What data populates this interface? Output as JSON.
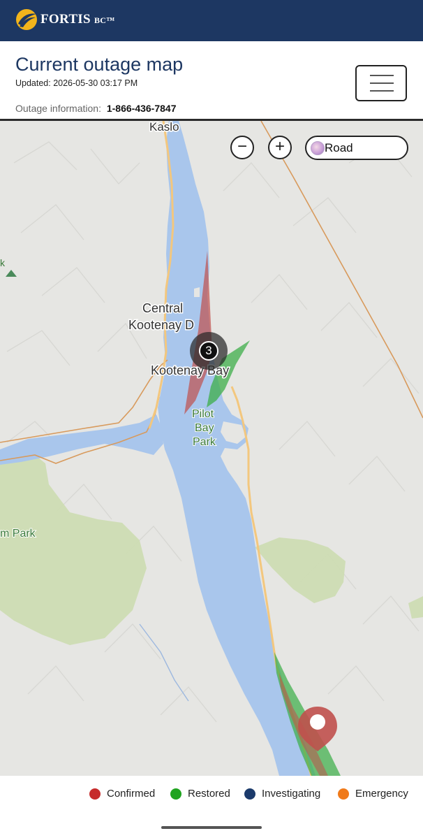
{
  "brand": {
    "name": "FORTIS",
    "suffix": "BC",
    "tm": "™",
    "colors": {
      "header_bg": "#1d3762",
      "logo_gold": "#f2b41b"
    }
  },
  "page": {
    "title": "Current outage map",
    "updated": "Updated: 2026-05-30 03:17 PM",
    "outage_info_label": "Outage information:",
    "outage_phone": "1-866-436-7847"
  },
  "menu": {
    "icon": "hamburger-menu-icon"
  },
  "map_controls": {
    "zoom_out_symbol": "−",
    "zoom_in_symbol": "+",
    "layer_label": "Road",
    "layer_icon": "globe-icon"
  },
  "map": {
    "labels": {
      "kaslo": "Kaslo",
      "central_kootenay_line1": "Central",
      "central_kootenay_line2": "Kootenay D",
      "kootenay_bay": "Kootenay Bay",
      "pilot_bay_line1": "Pilot",
      "pilot_bay_line2": "Bay",
      "pilot_bay_line3": "Park",
      "m_park": "m Park",
      "left_edge_k": "k"
    },
    "cluster_count": "3",
    "colors": {
      "water": "#a9c6ec",
      "land": "#e6e6e3",
      "park": "#cddcb3",
      "highway": "#f3c77e",
      "boundary": "#d89a5c",
      "confirmed": "#c0504d",
      "restored": "#3dae49"
    },
    "marker": {
      "type": "confirmed",
      "icon": "map-pin-icon"
    }
  },
  "legend": [
    {
      "label": "Confirmed",
      "color": "#c62b2b"
    },
    {
      "label": "Restored",
      "color": "#1fa31f"
    },
    {
      "label": "Investigating",
      "color": "#1b3a6b"
    },
    {
      "label": "Emergency",
      "color": "#f07a1a"
    }
  ]
}
